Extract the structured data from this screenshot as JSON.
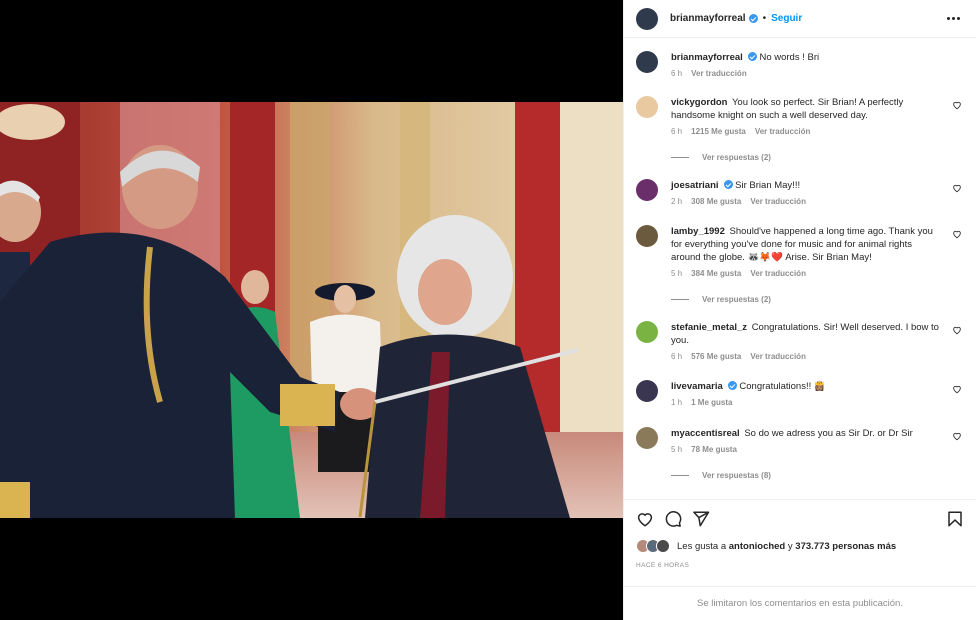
{
  "post": {
    "username": "brianmayforreal",
    "follow_label": "Seguir",
    "separator": "•"
  },
  "caption": {
    "username": "brianmayforreal",
    "text": "No words ! Bri",
    "time": "6 h",
    "translate": "Ver traducción"
  },
  "comments": [
    {
      "username": "vickygordon",
      "verified": false,
      "text": "You look so perfect. Sir Brian! A perfectly handsome knight on such a well deserved day.",
      "time": "6 h",
      "likes": "1215 Me gusta",
      "translate": "Ver traducción",
      "replies": "Ver respuestas (2)",
      "avatar_color": "#e8c9a0"
    },
    {
      "username": "joesatriani",
      "verified": true,
      "text": "Sir Brian May!!!",
      "time": "2 h",
      "likes": "308 Me gusta",
      "translate": "Ver traducción",
      "replies": "",
      "avatar_color": "#6a2f6b"
    },
    {
      "username": "lamby_1992",
      "verified": false,
      "text": "Should've happened a long time ago. Thank you for everything you've done for music and for animal rights around the globe. 🦝🦊❤️ Arise. Sir Brian May!",
      "time": "5 h",
      "likes": "384 Me gusta",
      "translate": "Ver traducción",
      "replies": "Ver respuestas (2)",
      "avatar_color": "#6b5a3e"
    },
    {
      "username": "stefanie_metal_z",
      "verified": false,
      "text": "Congratulations. Sir! Well deserved. I bow to you.",
      "time": "6 h",
      "likes": "576 Me gusta",
      "translate": "Ver traducción",
      "replies": "",
      "avatar_color": "#7bb342"
    },
    {
      "username": "livevamaria",
      "verified": true,
      "text": "Congratulations!! 👸🏽",
      "time": "1 h",
      "likes": "1 Me gusta",
      "translate": "",
      "replies": "",
      "avatar_color": "#3a3550"
    },
    {
      "username": "myaccentisreal",
      "verified": false,
      "text": "So do we adress you as Sir Dr. or Dr Sir",
      "time": "5 h",
      "likes": "78 Me gusta",
      "translate": "",
      "replies": "Ver respuestas (8)",
      "avatar_color": "#8a7a5a"
    }
  ],
  "likes_line": {
    "prefix": "Les gusta a",
    "user": "antonioched",
    "middle": "y",
    "count": "373.773 personas más"
  },
  "timestamp": "HACE 6 HORAS",
  "footer": "Se limitaron los comentarios en esta publicación.",
  "icons": {
    "header_more": "more-horizontal-icon",
    "comment_like": "heart-outline-icon",
    "like": "heart-icon",
    "comment": "comment-icon",
    "share": "paper-plane-icon",
    "save": "bookmark-icon"
  },
  "colors": {
    "link": "#0095f6",
    "verified": "#3897f0",
    "muted": "#8e8e8e",
    "text": "#262626",
    "border": "#efefef"
  }
}
